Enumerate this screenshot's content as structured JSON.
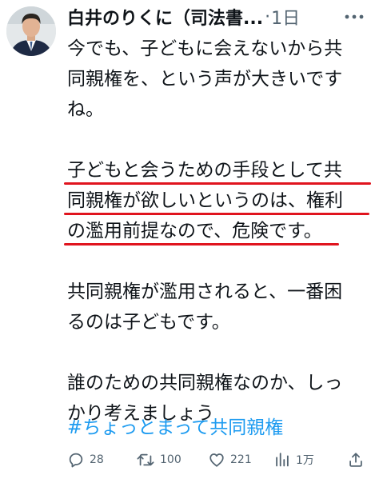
{
  "tweet": {
    "display_name": "白井のりくに（司法書...",
    "separator": "·",
    "time": "1日",
    "paragraphs": [
      [
        "今でも、子どもに会えないから共",
        "同親権を、という声が大きいです",
        "ね。"
      ],
      [
        "子どもと会うための手段として共",
        "同親権が欲しいというのは、権利",
        "の濫用前提なので、危険です。"
      ],
      [
        "共同親権が濫用されると、一番困",
        "るのは子どもです。"
      ],
      [
        "誰のための共同親権なのか、しっ",
        "かり考えましょう"
      ]
    ],
    "highlight_color": "#e0141e",
    "hashtag": "#ちょっとまって共同親権",
    "hashtag_color": "#1d9bf0"
  },
  "actions": {
    "reply": {
      "icon": "reply-icon",
      "count": "28"
    },
    "retweet": {
      "icon": "retweet-icon",
      "count": "100"
    },
    "like": {
      "icon": "heart-icon",
      "count": "221"
    },
    "views": {
      "icon": "views-chart-icon",
      "count": "1万"
    },
    "share": {
      "icon": "share-icon"
    }
  }
}
